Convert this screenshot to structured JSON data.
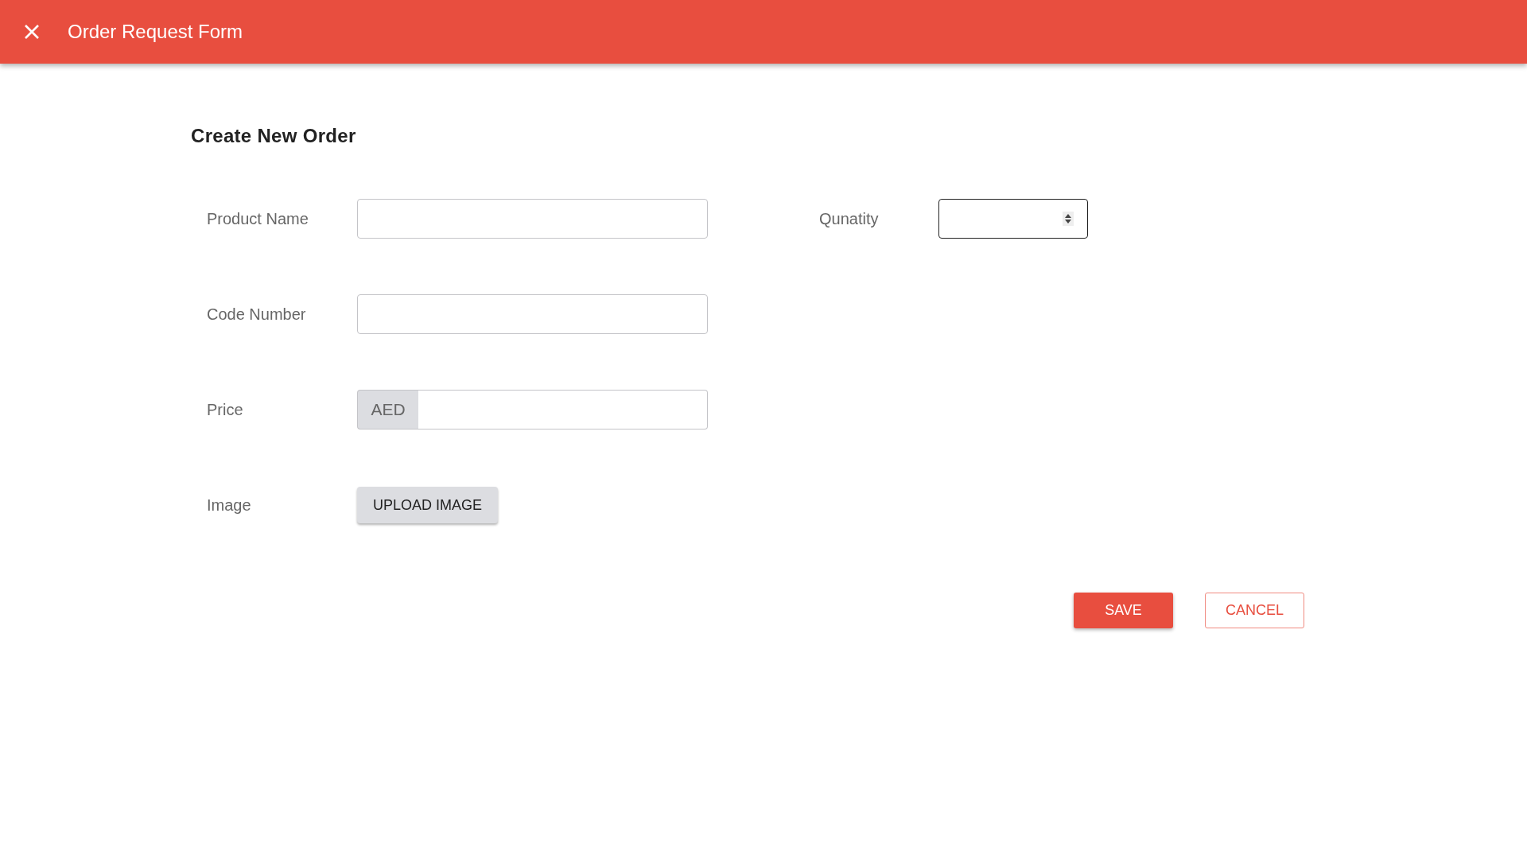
{
  "header": {
    "title": "Order Request Form"
  },
  "form": {
    "heading": "Create New Order",
    "rows": [
      {
        "fields": [
          {
            "label": "Product Name",
            "kind": "text",
            "focused": false
          },
          {
            "label": "Qunatity",
            "kind": "number",
            "focused": true
          }
        ]
      },
      {
        "fields": [
          {
            "label": "Code Number",
            "kind": "text",
            "focused": false
          }
        ]
      },
      {
        "fields": [
          {
            "label": "Price",
            "kind": "currency",
            "prefix": "AED",
            "focused": false
          }
        ]
      },
      {
        "fields": [
          {
            "label": "Image",
            "kind": "upload",
            "button": "UPLOAD IMAGE"
          }
        ]
      }
    ]
  },
  "actions": [
    {
      "label": "SAVE",
      "kind": "primary"
    },
    {
      "label": "CANCEL",
      "kind": "outline"
    }
  ]
}
